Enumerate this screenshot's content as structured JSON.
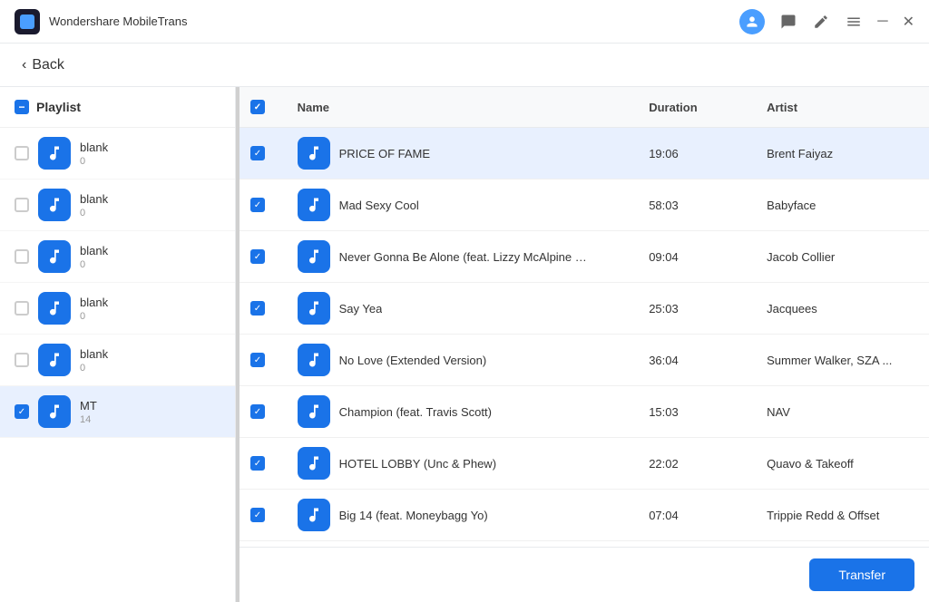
{
  "app": {
    "name": "Wondershare MobileTrans",
    "back_label": "Back"
  },
  "titlebar": {
    "icons": [
      "user",
      "message",
      "edit",
      "menu",
      "minimize",
      "close"
    ]
  },
  "sidebar": {
    "header_label": "Playlist",
    "header_checkbox": "partial",
    "items": [
      {
        "id": 1,
        "name": "blank",
        "count": "0",
        "checked": false
      },
      {
        "id": 2,
        "name": "blank",
        "count": "0",
        "checked": false
      },
      {
        "id": 3,
        "name": "blank",
        "count": "0",
        "checked": false
      },
      {
        "id": 4,
        "name": "blank",
        "count": "0",
        "checked": false
      },
      {
        "id": 5,
        "name": "blank",
        "count": "0",
        "checked": false
      },
      {
        "id": 6,
        "name": "MT",
        "count": "14",
        "checked": true,
        "selected": true
      }
    ]
  },
  "table": {
    "columns": [
      {
        "id": "checkbox",
        "label": ""
      },
      {
        "id": "name",
        "label": "Name"
      },
      {
        "id": "duration",
        "label": "Duration"
      },
      {
        "id": "artist",
        "label": "Artist"
      }
    ],
    "rows": [
      {
        "id": 1,
        "name": "PRICE OF FAME",
        "duration": "19:06",
        "artist": "Brent Faiyaz",
        "checked": true,
        "selected": true
      },
      {
        "id": 2,
        "name": "Mad Sexy Cool",
        "duration": "58:03",
        "artist": "Babyface",
        "checked": true
      },
      {
        "id": 3,
        "name": "Never Gonna Be Alone (feat. Lizzy McAlpine & J...",
        "duration": "09:04",
        "artist": "Jacob Collier",
        "checked": true
      },
      {
        "id": 4,
        "name": "Say Yea",
        "duration": "25:03",
        "artist": "Jacquees",
        "checked": true
      },
      {
        "id": 5,
        "name": "No Love (Extended Version)",
        "duration": "36:04",
        "artist": "Summer Walker, SZA ...",
        "checked": true
      },
      {
        "id": 6,
        "name": "Champion (feat. Travis Scott)",
        "duration": "15:03",
        "artist": "NAV",
        "checked": true
      },
      {
        "id": 7,
        "name": "HOTEL LOBBY (Unc & Phew)",
        "duration": "22:02",
        "artist": "Quavo & Takeoff",
        "checked": true
      },
      {
        "id": 8,
        "name": "Big 14 (feat. Moneybagg Yo)",
        "duration": "07:04",
        "artist": "Trippie Redd & Offset",
        "checked": true
      }
    ]
  },
  "footer": {
    "transfer_label": "Transfer"
  }
}
